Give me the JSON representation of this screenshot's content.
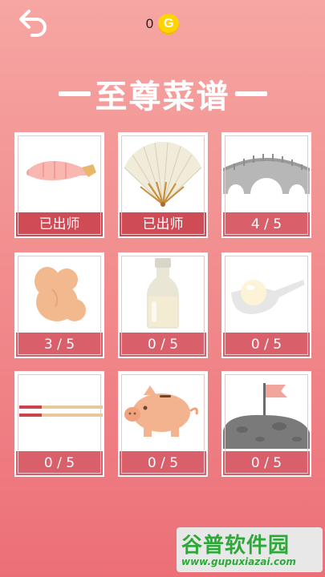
{
  "header": {
    "coin_count": "0",
    "coin_symbol": "G"
  },
  "title": "至尊菜谱",
  "recipes": [
    {
      "status": "已出师",
      "icon": "shrimp-icon"
    },
    {
      "status": "已出师",
      "icon": "folding-fan-icon"
    },
    {
      "status": "4 / 5",
      "icon": "arch-bridge-icon"
    },
    {
      "status": "3 / 5",
      "icon": "pretzel-bun-icon"
    },
    {
      "status": "0 / 5",
      "icon": "milk-bottle-icon"
    },
    {
      "status": "0 / 5",
      "icon": "rice-spoon-icon"
    },
    {
      "status": "0 / 5",
      "icon": "chopsticks-icon"
    },
    {
      "status": "0 / 5",
      "icon": "piggy-bank-icon"
    },
    {
      "status": "0 / 5",
      "icon": "moon-flag-icon"
    }
  ],
  "watermark": {
    "title": "谷普软件园",
    "url": "www.gupuxiazai.com"
  }
}
